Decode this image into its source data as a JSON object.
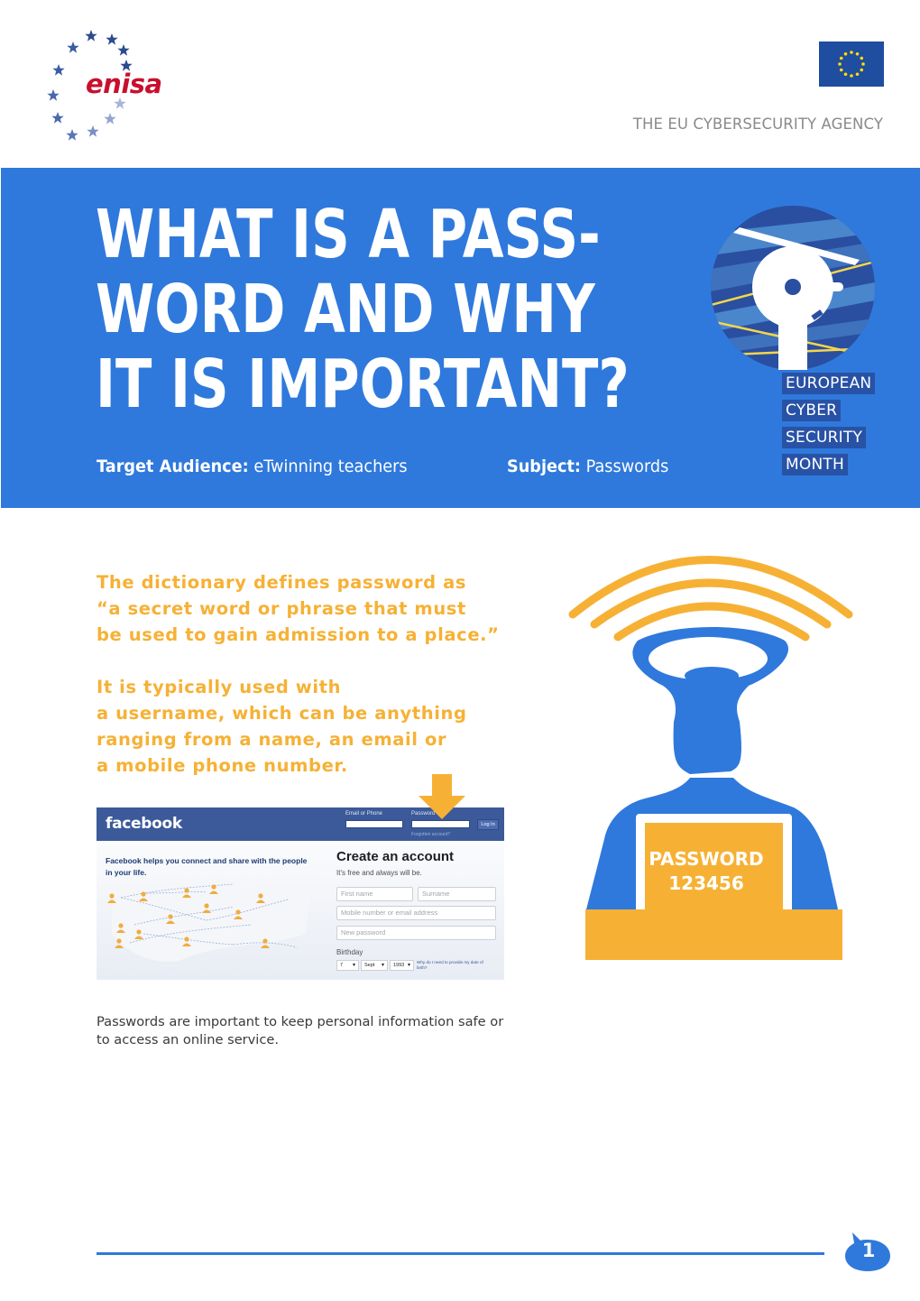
{
  "header": {
    "logo_text": "enisa",
    "agency_tagline": "THE EU CYBERSECURITY AGENCY",
    "icons": {
      "logo": "enisa-star-arc-logo",
      "flag": "eu-flag-icon"
    }
  },
  "hero": {
    "title_lines": [
      "WHAT IS A PASS-",
      "WORD AND WHY",
      "IT IS IMPORTANT?"
    ],
    "audience_label": "Target Audience:",
    "audience_value": "eTwinning teachers",
    "subject_label": "Subject:",
    "subject_value": "Passwords",
    "campaign_tags": [
      "EUROPEAN",
      "CYBER",
      "SECURITY",
      "MONTH"
    ],
    "colors": {
      "band": "#2f79dc",
      "tag_bg": "#2852a6",
      "accent_yellow": "#f6d54a"
    }
  },
  "content": {
    "lead_1": [
      "The dictionary defines password as",
      "“a secret word or phrase that must",
      "be used to gain admission to a place.”"
    ],
    "lead_2": [
      "It is typically used with",
      "a username, which can be anything",
      "ranging from a name, an email or",
      "a mobile phone number."
    ],
    "body": "Passwords are important to keep personal information safe or to access an online service.",
    "colors": {
      "lead": "#f6b135",
      "body": "#3a3a3a"
    }
  },
  "facebook_screenshot": {
    "logo": "facebook",
    "email_label": "Email or Phone",
    "password_label": "Password",
    "login_button": "Log In",
    "forgot_link": "Forgotten account?",
    "tagline": "Facebook helps you connect and share with the people in your life.",
    "create_title": "Create an account",
    "create_subtitle": "It's free and always will be.",
    "fields": {
      "first_name": "First name",
      "surname": "Surname",
      "mobile_email": "Mobile number or email address",
      "new_password": "New password"
    },
    "birthday_label": "Birthday",
    "birthday": {
      "day": "7",
      "month": "Sept",
      "year": "1993"
    },
    "why_birthday": "Why do I need to provide my date of birth?",
    "colors": {
      "bar": "#3c5a99"
    }
  },
  "illustration": {
    "password_title": "PASSWORD",
    "password_value": "123456",
    "icons": {
      "figure": "person-with-signal-icon",
      "arrow": "arrow-down-icon"
    },
    "colors": {
      "figure": "#2f79dc",
      "board": "#f6b135"
    }
  },
  "footer": {
    "page_number": "1"
  }
}
